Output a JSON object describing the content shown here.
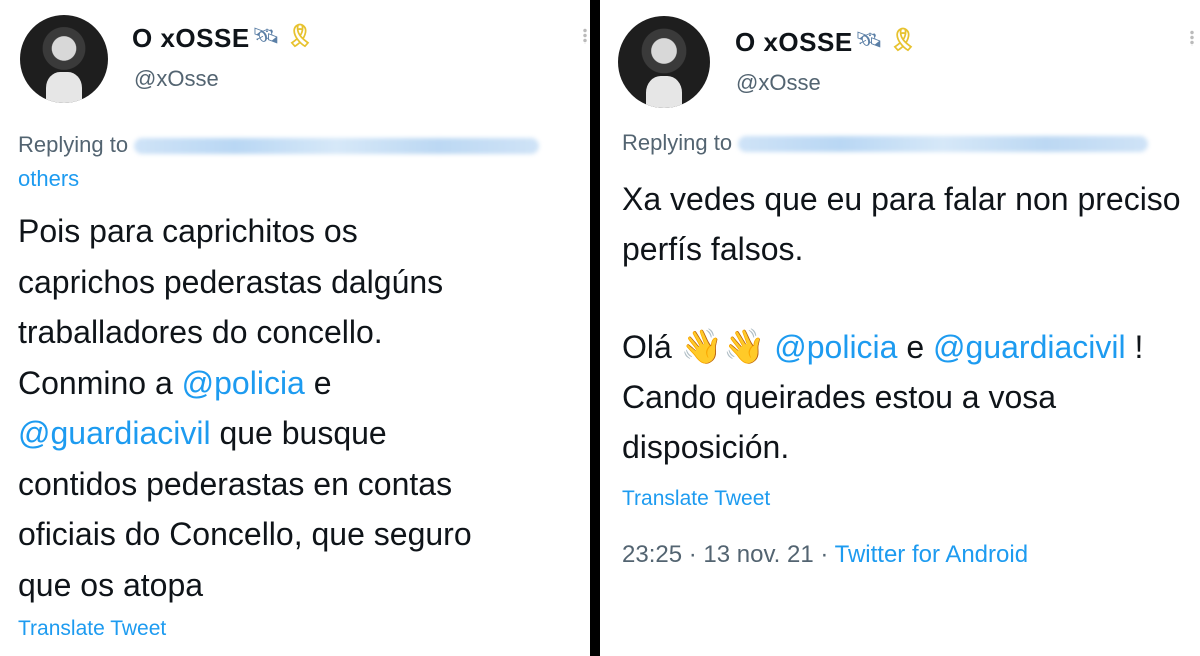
{
  "left_tweet": {
    "display_name": "O xOSSE",
    "name_icons": [
      "satellite-icon",
      "yellow-ribbon-icon"
    ],
    "handle": "@xOsse",
    "replying_prefix": "Replying to",
    "replying_tail": "others",
    "text_lines": [
      "Pois para caprichitos os",
      "caprichos pederastas dalgúns",
      "traballadores do concello.",
      "Conmino a ",
      "@policia",
      " e",
      "@guardiacivil",
      " que busque",
      "contidos pederastas en contas",
      "oficiais do Concello,  que seguro",
      "que os atopa"
    ],
    "translate_label": "Translate Tweet"
  },
  "right_tweet": {
    "display_name": "O xOSSE",
    "name_icons": [
      "satellite-icon",
      "yellow-ribbon-icon"
    ],
    "handle": "@xOsse",
    "replying_prefix": "Replying to",
    "para1": "Xa vedes que eu para falar non preciso perfís falsos.",
    "para2": {
      "greeting": "Olá",
      "emoji": "👋👋",
      "mention1": "@policia",
      "conj": "e",
      "mention2": "@guardiacivil",
      "rest": "! Cando queirades estou a vosa disposición."
    },
    "translate_label": "Translate Tweet",
    "time": "23:25",
    "date": "13 nov. 21",
    "source": "Twitter for Android",
    "separator": "·"
  },
  "colors": {
    "link": "#1d9bf0",
    "secondary_text": "#536471",
    "primary_text": "#0f1419",
    "divider": "#000000"
  }
}
